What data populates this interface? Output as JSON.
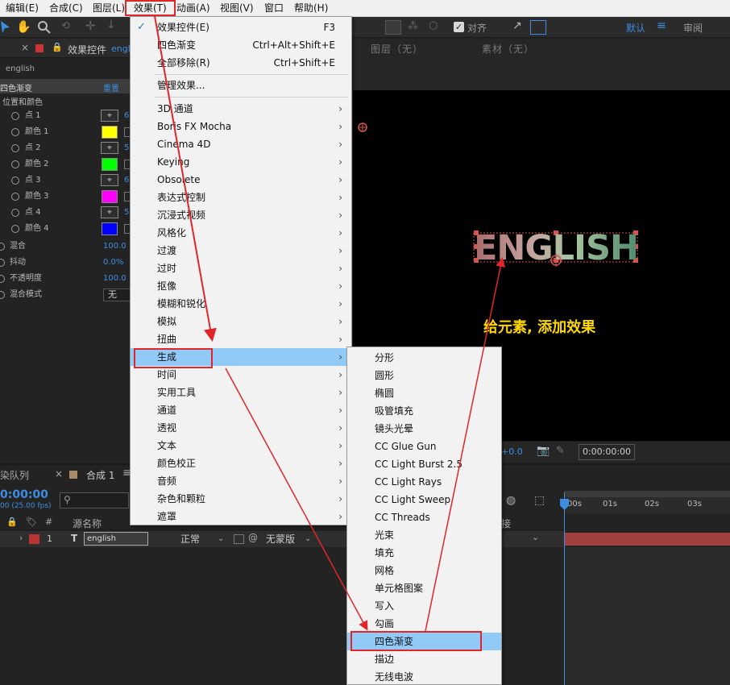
{
  "menubar": {
    "items": [
      "编辑(E)",
      "合成(C)",
      "图层(L)",
      "效果(T)",
      "动画(A)",
      "视图(V)",
      "窗口",
      "帮助(H)"
    ]
  },
  "toolbar": {
    "align_label": "对齐",
    "workspace_default": "默认",
    "workspace_review": "审阅"
  },
  "effects_panel": {
    "title": "效果控件",
    "title_suffix": "engl",
    "layer_name": "english",
    "effect_name": "四色渐变",
    "reset": "重置",
    "group_label": "位置和颜色",
    "rows": [
      {
        "label": "点 1",
        "value": "6"
      },
      {
        "label": "颜色 1",
        "color": "#ffff00"
      },
      {
        "label": "点 2",
        "value": "5"
      },
      {
        "label": "颜色 2",
        "color": "#00ff00"
      },
      {
        "label": "点 3",
        "value": "6"
      },
      {
        "label": "颜色 3",
        "color": "#ff00ff"
      },
      {
        "label": "点 4",
        "value": "5"
      },
      {
        "label": "颜色 4",
        "color": "#0000ff"
      }
    ],
    "blend_label": "混合",
    "blend_value": "100.0",
    "jitter_label": "抖动",
    "jitter_value": "0.0%",
    "opacity_label": "不透明度",
    "opacity_value": "100.0",
    "blend_mode_label": "混合模式",
    "blend_mode_value": "无"
  },
  "comp_panel": {
    "layer_label": "图层（无）",
    "footage_label": "素材（无）",
    "text": "ENGLISH",
    "annotation": "给元素, 添加效果",
    "offset_value": "+0.0",
    "timecode": "0:00:00:00"
  },
  "timeline": {
    "render_queue": "染队列",
    "comp_tab": "合成 1",
    "timecode": "0:00:00",
    "fps": "00 (25.00 fps)",
    "col_hash": "#",
    "col_source": "源名称",
    "col_parent": "接",
    "layer_index": "1",
    "layer_name": "english",
    "mode": "正常",
    "trkmat": "无蒙版",
    "ruler": [
      "00s",
      "01s",
      "02s",
      "03s"
    ]
  },
  "effect_menu": {
    "items": [
      {
        "label": "效果控件(E)",
        "shortcut": "F3",
        "checked": true
      },
      {
        "label": "四色渐变",
        "shortcut": "Ctrl+Alt+Shift+E"
      },
      {
        "label": "全部移除(R)",
        "shortcut": "Ctrl+Shift+E"
      },
      {
        "label": "管理效果..."
      },
      {
        "label": "3D 通道",
        "submenu": true
      },
      {
        "label": "Boris FX Mocha",
        "submenu": true
      },
      {
        "label": "Cinema 4D",
        "submenu": true
      },
      {
        "label": "Keying",
        "submenu": true
      },
      {
        "label": "Obsolete",
        "submenu": true
      },
      {
        "label": "表达式控制",
        "submenu": true
      },
      {
        "label": "沉浸式视频",
        "submenu": true
      },
      {
        "label": "风格化",
        "submenu": true
      },
      {
        "label": "过渡",
        "submenu": true
      },
      {
        "label": "过时",
        "submenu": true
      },
      {
        "label": "抠像",
        "submenu": true
      },
      {
        "label": "模糊和锐化",
        "submenu": true
      },
      {
        "label": "模拟",
        "submenu": true
      },
      {
        "label": "扭曲",
        "submenu": true
      },
      {
        "label": "生成",
        "submenu": true,
        "highlighted": true
      },
      {
        "label": "时间",
        "submenu": true
      },
      {
        "label": "实用工具",
        "submenu": true
      },
      {
        "label": "通道",
        "submenu": true
      },
      {
        "label": "透视",
        "submenu": true
      },
      {
        "label": "文本",
        "submenu": true
      },
      {
        "label": "颜色校正",
        "submenu": true
      },
      {
        "label": "音频",
        "submenu": true
      },
      {
        "label": "杂色和颗粒",
        "submenu": true
      },
      {
        "label": "遮罩",
        "submenu": true
      }
    ]
  },
  "generate_submenu": {
    "items": [
      {
        "label": "分形"
      },
      {
        "label": "圆形"
      },
      {
        "label": "椭圆"
      },
      {
        "label": "吸管填充"
      },
      {
        "label": "镜头光晕"
      },
      {
        "label": "CC Glue Gun"
      },
      {
        "label": "CC Light Burst 2.5"
      },
      {
        "label": "CC Light Rays"
      },
      {
        "label": "CC Light Sweep"
      },
      {
        "label": "CC Threads"
      },
      {
        "label": "光束"
      },
      {
        "label": "填充"
      },
      {
        "label": "网格"
      },
      {
        "label": "单元格图案"
      },
      {
        "label": "写入"
      },
      {
        "label": "勾画"
      },
      {
        "label": "四色渐变",
        "highlighted": true
      },
      {
        "label": "描边"
      },
      {
        "label": "无线电波"
      }
    ]
  },
  "colors": {
    "highlight": "#91c9f7",
    "annotation_red": "#e0262a",
    "annotation_yellow": "#ffd700",
    "link_blue": "#3d8ee0",
    "timeline_clip": "#a04040"
  }
}
